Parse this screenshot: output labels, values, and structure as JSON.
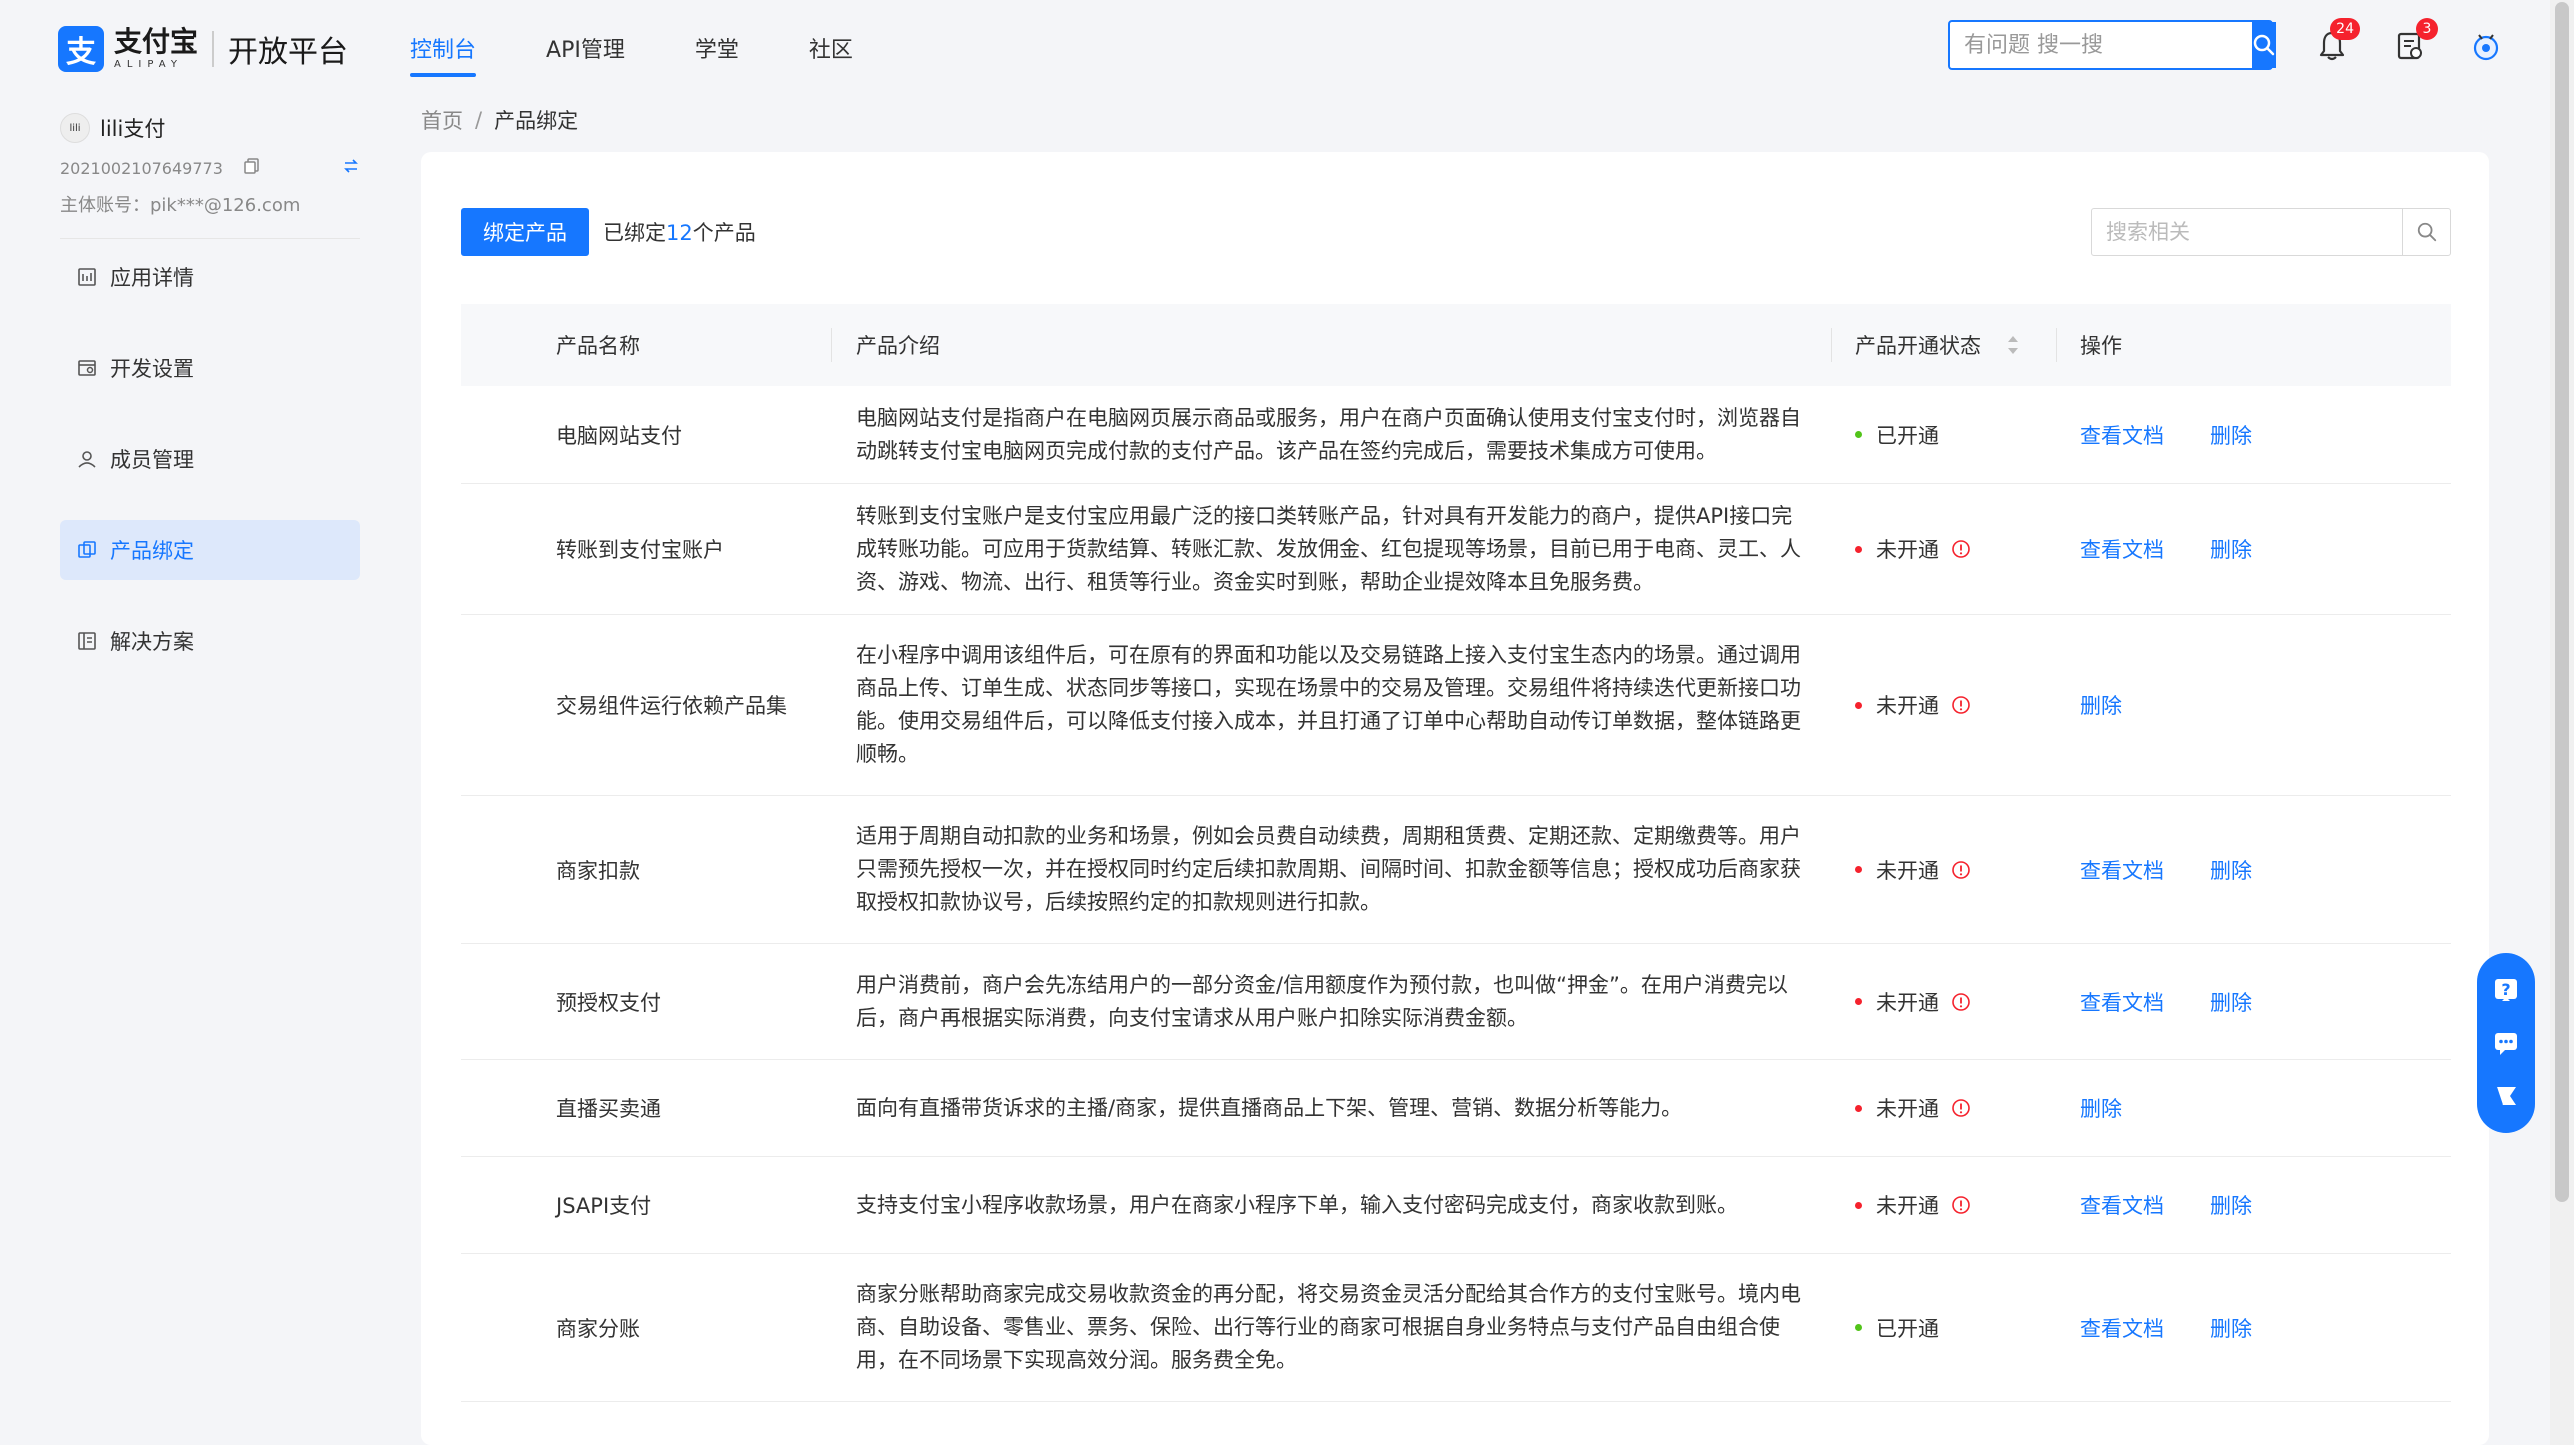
{
  "header": {
    "logo_mark": "支",
    "logo_cn": "支付宝",
    "logo_en": "ALIPAY",
    "platform": "开放平台",
    "nav": [
      {
        "label": "控制台",
        "active": true
      },
      {
        "label": "API管理",
        "active": false
      },
      {
        "label": "学堂",
        "active": false
      },
      {
        "label": "社区",
        "active": false
      }
    ],
    "search_placeholder": "有问题 搜一搜",
    "notifications_count": "24",
    "tasks_count": "3"
  },
  "account": {
    "avatar_text": "lili",
    "name": "lili支付",
    "app_id": "2021002107649773",
    "main_account": "主体账号：pik***@126.com"
  },
  "sidebar": {
    "items": [
      {
        "label": "应用详情",
        "icon": "app-detail-icon",
        "active": false
      },
      {
        "label": "开发设置",
        "icon": "dev-settings-icon",
        "active": false
      },
      {
        "label": "成员管理",
        "icon": "members-icon",
        "active": false
      },
      {
        "label": "产品绑定",
        "icon": "product-bind-icon",
        "active": true
      },
      {
        "label": "解决方案",
        "icon": "solutions-icon",
        "active": false
      }
    ]
  },
  "breadcrumb": {
    "home": "首页",
    "separator": "/",
    "current": "产品绑定"
  },
  "toolbar": {
    "bind_button": "绑定产品",
    "bound_prefix": "已绑定",
    "bound_count": "12",
    "bound_suffix": "个产品",
    "search_placeholder": "搜索相关"
  },
  "table": {
    "columns": {
      "name": "产品名称",
      "desc": "产品介绍",
      "status": "产品开通状态",
      "ops": "操作"
    },
    "rows": [
      {
        "name": "电脑网站支付",
        "desc": "电脑网站支付是指商户在电脑网页展示商品或服务，用户在商户页面确认使用支付宝支付时，浏览器自动跳转支付宝电脑网页完成付款的支付产品。该产品在签约完成后，需要技术集成方可使用。",
        "status": "已开通",
        "opened": true,
        "view_doc": "查看文档",
        "delete": "删除",
        "height": 98
      },
      {
        "name": "转账到支付宝账户",
        "desc": "转账到支付宝账户是支付宝应用最广泛的接口类转账产品，针对具有开发能力的商户，提供API接口完成转账功能。可应用于货款结算、转账汇款、发放佣金、红包提现等场景，目前已用于电商、灵工、人资、游戏、物流、出行、租赁等行业。资金实时到账，帮助企业提效降本且免服务费。",
        "status": "未开通",
        "opened": false,
        "view_doc": "查看文档",
        "delete": "删除",
        "height": 131
      },
      {
        "name": "交易组件运行依赖产品集",
        "desc": "在小程序中调用该组件后，可在原有的界面和功能以及交易链路上接入支付宝生态内的场景。通过调用商品上传、订单生成、状态同步等接口，实现在场景中的交易及管理。交易组件将持续迭代更新接口功能。使用交易组件后，可以降低支付接入成本，并且打通了订单中心帮助自动传订单数据，整体链路更顺畅。",
        "status": "未开通",
        "opened": false,
        "view_doc": "",
        "delete": "删除",
        "height": 181
      },
      {
        "name": "商家扣款",
        "desc": "适用于周期自动扣款的业务和场景，例如会员费自动续费，周期租赁费、定期还款、定期缴费等。用户只需预先授权一次，并在授权同时约定后续扣款周期、间隔时间、扣款金额等信息；授权成功后商家获取授权扣款协议号，后续按照约定的扣款规则进行扣款。",
        "status": "未开通",
        "opened": false,
        "view_doc": "查看文档",
        "delete": "删除",
        "height": 148
      },
      {
        "name": "预授权支付",
        "desc": "用户消费前，商户会先冻结用户的一部分资金/信用额度作为预付款，也叫做“押金”。在用户消费完以后，商户再根据实际消费，向支付宝请求从用户账户扣除实际消费金额。",
        "status": "未开通",
        "opened": false,
        "view_doc": "查看文档",
        "delete": "删除",
        "height": 116
      },
      {
        "name": "直播买卖通",
        "desc": "面向有直播带货诉求的主播/商家，提供直播商品上下架、管理、营销、数据分析等能力。",
        "status": "未开通",
        "opened": false,
        "view_doc": "",
        "delete": "删除",
        "height": 97
      },
      {
        "name": "JSAPI支付",
        "desc": "支持支付宝小程序收款场景，用户在商家小程序下单，输入支付密码完成支付，商家收款到账。",
        "status": "未开通",
        "opened": false,
        "view_doc": "查看文档",
        "delete": "删除",
        "height": 97
      },
      {
        "name": "商家分账",
        "desc": "商家分账帮助商家完成交易收款资金的再分配，将交易资金灵活分配给其合作方的支付宝账号。境内电商、自助设备、零售业、票务、保险、出行等行业的商家可根据自身业务特点与支付产品自由组合使用，在不同场景下实现高效分润。服务费全免。",
        "status": "已开通",
        "opened": true,
        "view_doc": "查看文档",
        "delete": "删除",
        "height": 148
      }
    ]
  },
  "colors": {
    "primary": "#1677ff",
    "opened": "#52c41a",
    "closed": "#f5222d"
  }
}
